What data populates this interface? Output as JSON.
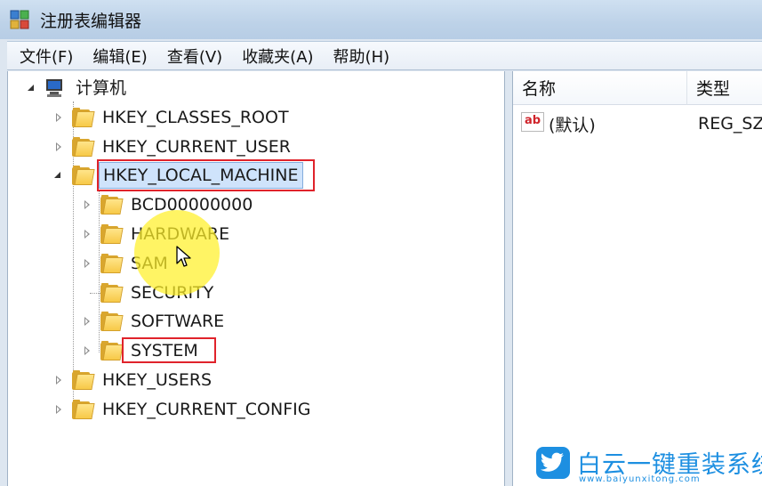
{
  "window": {
    "title": "注册表编辑器",
    "icon": "registry-editor-icon"
  },
  "menubar": {
    "items": [
      "文件(F)",
      "编辑(E)",
      "查看(V)",
      "收藏夹(A)",
      "帮助(H)"
    ]
  },
  "tree": {
    "root": "计算机",
    "hives": [
      {
        "label": "HKEY_CLASSES_ROOT"
      },
      {
        "label": "HKEY_CURRENT_USER"
      },
      {
        "label": "HKEY_LOCAL_MACHINE",
        "selected": true
      }
    ],
    "local_machine_children": [
      {
        "label": "BCD00000000"
      },
      {
        "label": "HARDWARE"
      },
      {
        "label": "SAM"
      },
      {
        "label": "SECURITY"
      },
      {
        "label": "SOFTWARE"
      },
      {
        "label": "SYSTEM",
        "highlighted": true
      }
    ],
    "more_hives": [
      {
        "label": "HKEY_USERS"
      },
      {
        "label": "HKEY_CURRENT_CONFIG"
      }
    ]
  },
  "list": {
    "columns": {
      "name": "名称",
      "type": "类型"
    },
    "rows": [
      {
        "icon": "string-value-icon",
        "icon_text": "ab",
        "name": "(默认)",
        "type": "REG_SZ"
      }
    ]
  },
  "watermark": {
    "main": "白云一键重装系统",
    "sub": "www.baiyunxitong.com",
    "color": "#1d8fe1"
  },
  "colors": {
    "highlight_box": "#e0232b",
    "cursor_highlight": "#fff028",
    "selection_bg": "#cfe3fb"
  }
}
